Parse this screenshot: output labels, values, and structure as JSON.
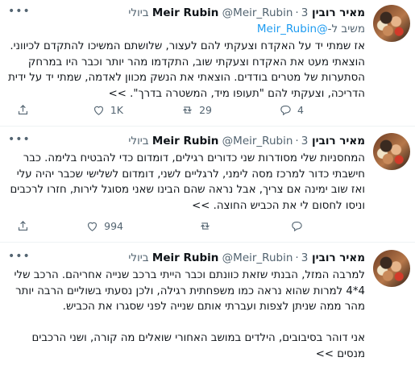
{
  "tweets": [
    {
      "name": "מאיר רובין Meir Rubin",
      "handle": "@Meir_Rubin",
      "date": "3 ביולי",
      "reply_prefix": "משיב ל-",
      "reply_handle": "@Meir_Rubin",
      "text": "אז שמתי יד על האקדח וצעקתי להם לעצור, שלושתם המשיכו להתקדם לכיווני. הוצאתי מעט את האקדח וצעקתי שוב, התקדמו מהר יותר וכבר היו במרחק הסתערות של מטרים בודדים. הוצאתי את הנשק מכוון לאדמה, שמתי יד על ידית הדריכה, וצעקתי להם \"תעופו מיד, המשטרה בדרך\". >>",
      "retweets": "",
      "likes": "1K",
      "replies": "29",
      "shares": "4"
    },
    {
      "name": "מאיר רובין Meir Rubin",
      "handle": "@Meir_Rubin",
      "date": "3 ביולי",
      "text": "המחסניות שלי מסודרות שני כדורים רגילים, דומדום כדי להבטיח בלימה. כבר חישבתי כדור למרכז מסה לימני, לרגליים לשני, דומדום לשלישי שכבר יהיה עלי ואז שוב ימינה אם צריך, אבל נראה שהם הבינו שאני מסוגל לירות, חזרו לרכבים וניסו לחסום לי את הכביש החוצה. >>",
      "likes": "994",
      "replies": "",
      "shares": ""
    },
    {
      "name": "מאיר רובין Meir Rubin",
      "handle": "@Meir_Rubin",
      "date": "3 ביולי",
      "text": "למרבה המזל, הבנתי שזאת כוונתם וכבר הייתי ברכב שנייה אחריהם. הרכב שלי 4*4 למרות שהוא נראה כמו משפחתית רגילה, ולכן נסעתי בשוליים הרבה יותר מהר ממה שניתן לצפות ועברתי אותם שנייה לפני שסגרו את הכביש.\n\nאני דוהר בסיבובים, הילדים במושב האחורי שואלים מה קורה, ושני הרכבים מנסים >>"
    }
  ],
  "icons": {
    "more": "more-icon",
    "reply": "reply-icon",
    "retweet": "retweet-icon",
    "like": "like-icon",
    "share": "share-icon"
  }
}
